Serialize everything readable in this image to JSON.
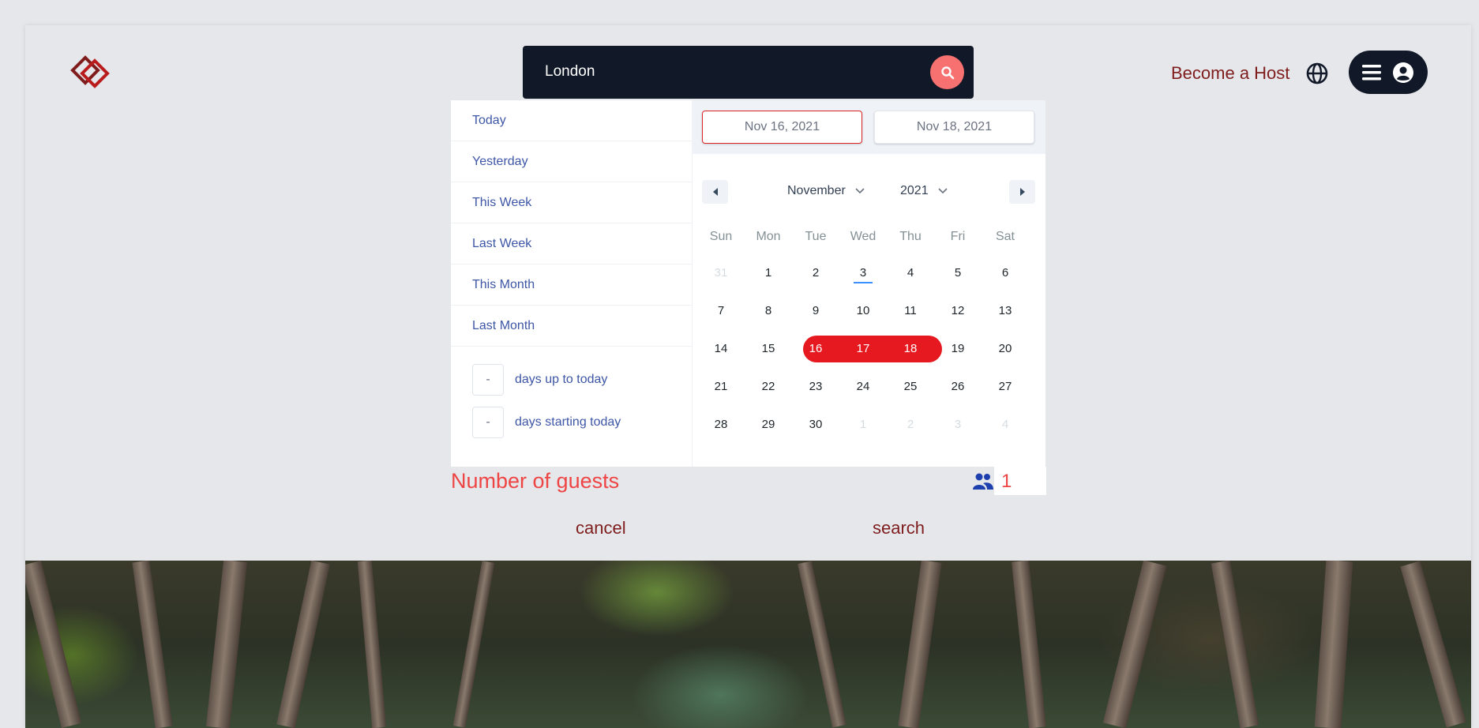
{
  "header": {
    "search_value": "London",
    "become_host_label": "Become a Host"
  },
  "picker": {
    "static_ranges": [
      "Today",
      "Yesterday",
      "This Week",
      "Last Week",
      "This Month",
      "Last Month"
    ],
    "input_ranges": [
      {
        "value": "-",
        "label": "days up to today"
      },
      {
        "value": "-",
        "label": "days starting today"
      }
    ],
    "start_date": "Nov 16, 2021",
    "end_date": "Nov 18, 2021",
    "month": "November",
    "year": "2021",
    "weekdays": [
      "Sun",
      "Mon",
      "Tue",
      "Wed",
      "Thu",
      "Fri",
      "Sat"
    ],
    "weeks": [
      [
        "31",
        "1",
        "2",
        "3",
        "4",
        "5",
        "6"
      ],
      [
        "7",
        "8",
        "9",
        "10",
        "11",
        "12",
        "13"
      ],
      [
        "14",
        "15",
        "16",
        "17",
        "18",
        "19",
        "20"
      ],
      [
        "21",
        "22",
        "23",
        "24",
        "25",
        "26",
        "27"
      ],
      [
        "28",
        "29",
        "30",
        "1",
        "2",
        "3",
        "4"
      ]
    ]
  },
  "guests": {
    "label": "Number of guests",
    "count": "1"
  },
  "actions": {
    "cancel_label": "cancel",
    "search_label": "search"
  },
  "colors": {
    "accent": "#e5191f",
    "brand_dark": "#7f1d1d",
    "search_button": "#f87171",
    "nav_dark": "#111827"
  }
}
